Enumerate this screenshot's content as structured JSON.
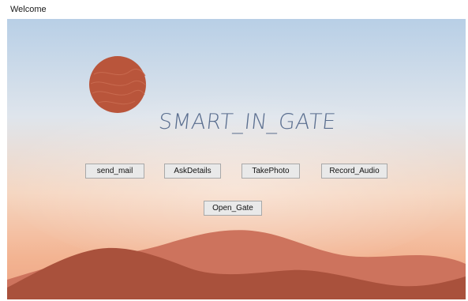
{
  "window": {
    "title": "Welcome"
  },
  "app": {
    "title": "SMART_IN_GATE"
  },
  "buttons": {
    "send_mail": "send_mail",
    "ask_details": "AskDetails",
    "take_photo": "TakePhoto",
    "record_audio": "Record_Audio",
    "open_gate": "Open_Gate"
  },
  "colors": {
    "sun": "#b9553b",
    "title_text": "#5a6e8f",
    "hill_back": "#cf7660",
    "hill_front": "#a9513c",
    "sky_top": "#c4d7e8",
    "sky_bottom": "#f2b593"
  }
}
